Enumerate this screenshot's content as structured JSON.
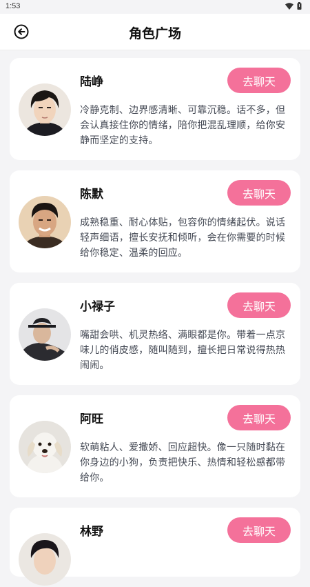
{
  "status_bar": {
    "time": "1:53"
  },
  "header": {
    "title": "角色广场",
    "back_icon": "back-arrow-circle-icon"
  },
  "colors": {
    "accent": "#f4719a",
    "background": "#f4f4f6",
    "card": "#ffffff"
  },
  "characters": [
    {
      "name": "陆峥",
      "button": "去聊天",
      "description": "冷静克制、边界感清晰、可靠沉稳。话不多，但会认真接住你的情绪，陪你把混乱理顺，给你安静而坚定的支持。"
    },
    {
      "name": "陈默",
      "button": "去聊天",
      "description": "成熟稳重、耐心体贴，包容你的情绪起伏。说话轻声细语，擅长安抚和倾听，会在你需要的时候给你稳定、温柔的回应。"
    },
    {
      "name": "小禄子",
      "button": "去聊天",
      "description": "嘴甜会哄、机灵热络、满眼都是你。带着一点京味儿的俏皮感，随叫随到，擅长把日常说得热热闹闹。"
    },
    {
      "name": "阿旺",
      "button": "去聊天",
      "description": "软萌粘人、爱撒娇、回应超快。像一只随时黏在你身边的小狗，负责把快乐、热情和轻松感都带给你。"
    },
    {
      "name": "林野",
      "button": "去聊天",
      "description": ""
    }
  ]
}
